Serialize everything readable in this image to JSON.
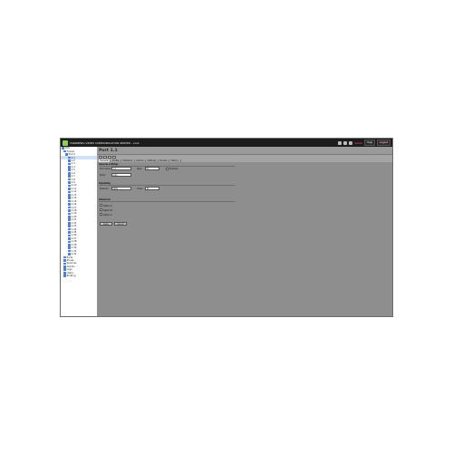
{
  "window": {
    "title": "TANDBERG VIDEO COMMUNICATION SERVER  -  vcs1",
    "user": "admin",
    "buttons": {
      "help": "Help",
      "logout": "Logout"
    }
  },
  "sidebar": {
    "items": [
      "VCS",
      "Trunks",
      "Port 1",
      "1.1",
      "1.2",
      "1.3",
      "1.4",
      "1.5",
      "1.6",
      "1.7",
      "1.8",
      "1.9",
      "1.10",
      "1.11",
      "1.12",
      "1.13",
      "1.14",
      "1.15",
      "1.16",
      "1.17",
      "1.18",
      "1.19",
      "1.20",
      "1.21",
      "1.22",
      "1.23",
      "1.24",
      "1.25",
      "1.26",
      "1.27",
      "1.28",
      "1.29",
      "1.30",
      "1.31",
      "1.32",
      "Ports",
      "Zones",
      "Services",
      "Alarms",
      "Logs",
      "Users",
      "Routing"
    ],
    "selected_index": 3
  },
  "main": {
    "heading": "Port 1.1",
    "tabs": [
      "General",
      "Profile",
      "Statistics",
      "Alarms",
      "Settings",
      "Routes",
      "History"
    ],
    "active_tab": 0
  },
  "form": {
    "sec1": "General settings",
    "name_label": "Port name",
    "name_value": "1.1",
    "type_label": "Type",
    "type_value": "E1",
    "enabled_label": "Enabled",
    "mode_label": "Mode",
    "mode_value": "Auto",
    "sec2": "Signalling",
    "proto_label": "Protocol",
    "proto_value": "ISDN",
    "timer_label": "Timer",
    "timer_value": "30",
    "sec3": "Advanced",
    "opt_a": "Option A",
    "opt_b": "Option B",
    "opt_c": "Option C",
    "apply": "Apply",
    "cancel": "Cancel"
  }
}
